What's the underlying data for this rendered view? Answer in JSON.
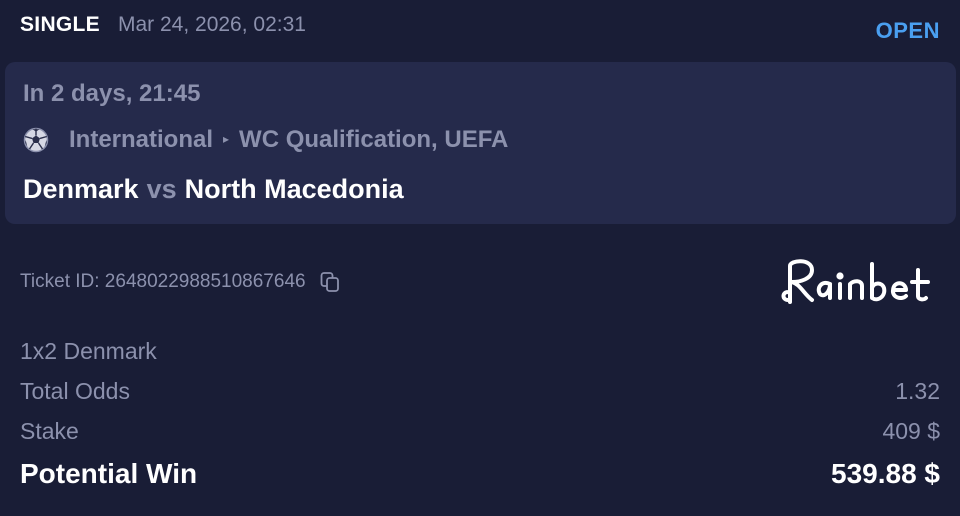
{
  "header": {
    "bet_type": "SINGLE",
    "date": "Mar 24, 2026, 02:31",
    "status": "OPEN",
    "status_color": "#4a9ff0"
  },
  "event": {
    "time": "In 2 days, 21:45",
    "sport_icon": "soccer-ball-icon",
    "category": "International",
    "separator_icon": "caret-right-icon",
    "league": "WC Qualification, UEFA",
    "home_team": "Denmark",
    "vs": "vs",
    "away_team": "North Macedonia"
  },
  "ticket": {
    "label": "Ticket ID: 2648022988510867646",
    "copy_icon": "copy-icon"
  },
  "brand": {
    "name": "Rainbet"
  },
  "bet": {
    "selection": "1x2 Denmark",
    "odds_label": "Total Odds",
    "odds_value": "1.32",
    "stake_label": "Stake",
    "stake_value": "409 $",
    "win_label": "Potential Win",
    "win_value": "539.88 $"
  },
  "colors": {
    "background": "#191d36",
    "card": "#252a4b",
    "muted_text": "#8c91ad",
    "primary_text": "#ffffff"
  }
}
